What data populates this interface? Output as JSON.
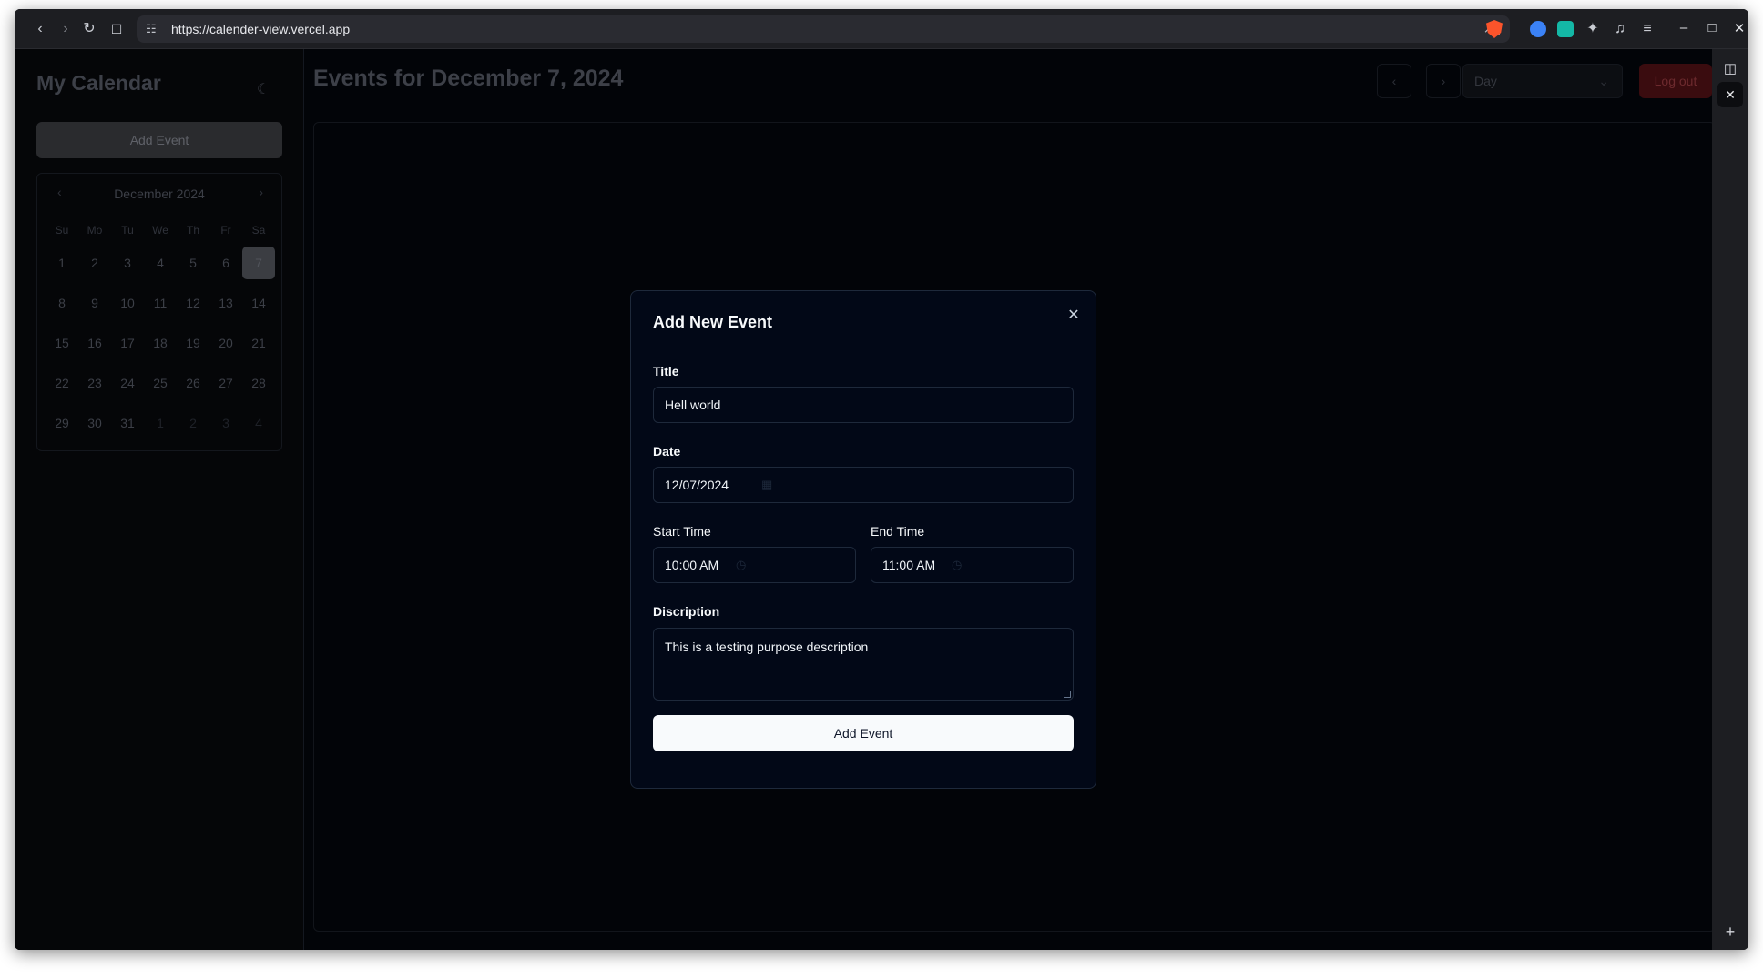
{
  "browser": {
    "url": "https://calender-view.vercel.app",
    "icons": [
      "back-icon",
      "forward-icon",
      "reload-icon",
      "bookmark-icon",
      "site-settings-icon",
      "share-icon",
      "brave-shield-icon",
      "extension-icon",
      "puzzle-icon",
      "music-icon",
      "menu-icon",
      "minimize-icon",
      "maximize-icon",
      "close-icon"
    ]
  },
  "sidebar": {
    "title": "My Calendar",
    "add_event_label": "Add Event",
    "mini_calendar": {
      "month_label": "December 2024",
      "weekdays": [
        "Su",
        "Mo",
        "Tu",
        "We",
        "Th",
        "Fr",
        "Sa"
      ],
      "days": [
        "1",
        "2",
        "3",
        "4",
        "5",
        "6",
        "7",
        "8",
        "9",
        "10",
        "11",
        "12",
        "13",
        "14",
        "15",
        "16",
        "17",
        "18",
        "19",
        "20",
        "21",
        "22",
        "23",
        "24",
        "25",
        "26",
        "27",
        "28",
        "29",
        "30",
        "31",
        "1",
        "2",
        "3",
        "4"
      ],
      "selected_day": "7"
    }
  },
  "header": {
    "title": "Events for December 7, 2024",
    "view_select_value": "Day",
    "logout_label": "Log out"
  },
  "modal": {
    "title": "Add New Event",
    "title_label": "Title",
    "title_value": "Hell world",
    "date_label": "Date",
    "date_value": "12/07/2024",
    "start_time_label": "Start Time",
    "start_time_value": "10:00 AM",
    "end_time_label": "End Time",
    "end_time_value": "11:00 AM",
    "description_label": "Discription",
    "description_value": "This is a testing purpose description",
    "submit_label": "Add Event"
  },
  "colors": {
    "modal_bg": "#020817",
    "border": "#1e293b",
    "primary_button": "#f8fafc",
    "logout": "#3a0c0f"
  }
}
